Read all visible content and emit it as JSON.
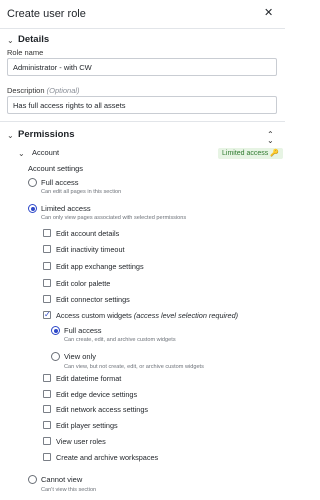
{
  "header": {
    "title": "Create user role",
    "close_icon": "close-icon"
  },
  "details": {
    "title": "Details",
    "role_name_label": "Role name",
    "role_name_value": "Administrator - with CW",
    "description_label": "Description",
    "description_optional": "(Optional)",
    "description_value": "Has full access rights to all assets"
  },
  "permissions": {
    "title": "Permissions",
    "account": {
      "title": "Account",
      "badge": "Limited access",
      "settings_label": "Account settings",
      "full_access": {
        "title": "Full access",
        "desc": "Can edit all pages in this section",
        "selected": false
      },
      "limited_access": {
        "title": "Limited access",
        "desc": "Can only view pages associated with selected permissions",
        "selected": true
      },
      "items_before": [
        {
          "label": "Edit account details",
          "checked": false
        },
        {
          "label": "Edit inactivity timeout",
          "checked": false
        },
        {
          "label": "Edit app exchange settings",
          "checked": false
        },
        {
          "label": "Edit color palette",
          "checked": false
        },
        {
          "label": "Edit connector settings",
          "checked": false
        }
      ],
      "custom_widgets": {
        "label": "Access custom widgets",
        "note": "(access level selection required)",
        "checked": true,
        "full_access": {
          "title": "Full access",
          "desc": "Can create, edit, and archive custom widgets",
          "selected": true
        },
        "view_only": {
          "title": "View only",
          "desc": "Can view, but not create, edit, or archive custom widgets",
          "selected": false
        }
      },
      "items_after": [
        {
          "label": "Edit datetime format",
          "checked": false
        },
        {
          "label": "Edit edge device settings",
          "checked": false
        },
        {
          "label": "Edit network access settings",
          "checked": false
        },
        {
          "label": "Edit player settings",
          "checked": false
        },
        {
          "label": "View user roles",
          "checked": false
        },
        {
          "label": "Create and archive workspaces",
          "checked": false
        }
      ],
      "cannot_view": {
        "title": "Cannot view",
        "desc": "Can't view this section",
        "selected": false
      }
    }
  },
  "colors": {
    "accent": "#2f49c9",
    "badge_bg": "#e7f4e4",
    "badge_text": "#2f7a2f"
  }
}
